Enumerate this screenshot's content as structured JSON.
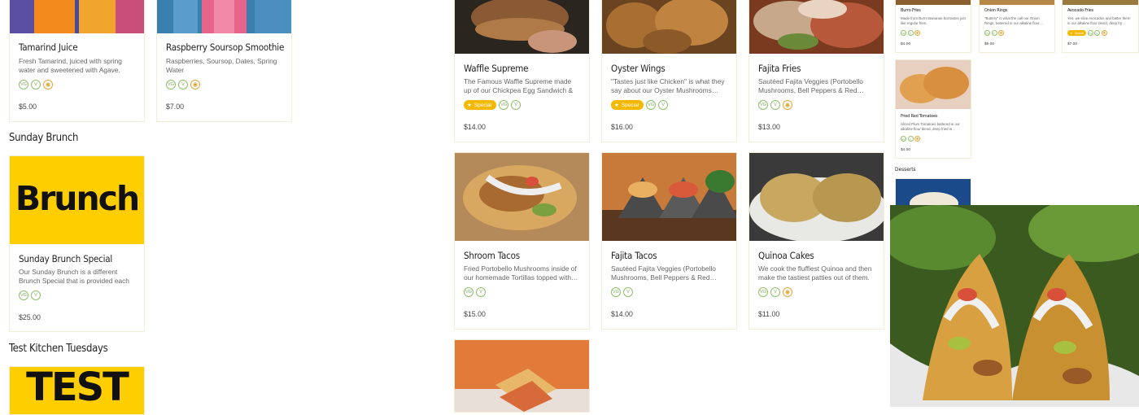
{
  "colors": {
    "accent": "#f5b800",
    "vegan_green": "#7aa85a",
    "gluten_free_gold": "#e0a83a",
    "card_border": "#f3ecd6"
  },
  "left": {
    "drinks": [
      {
        "title": "Tamarind Juice",
        "desc": "Fresh Tamarind, juiced with spring water and sweetened with Agave.",
        "price": "$5.00"
      },
      {
        "title": "Raspberry Soursop Smoothie",
        "desc": "Raspberries, Soursop, Dates, Spring Water",
        "price": "$7.00"
      }
    ],
    "sunday_brunch": {
      "heading": "Sunday Brunch",
      "banner_text": "Brunch",
      "title": "Sunday Brunch Special",
      "desc": "Our Sunday Brunch is a different Brunch Special that is provided each week.…",
      "price": "$25.00"
    },
    "test_kitchen": {
      "heading": "Test Kitchen Tuesdays",
      "banner_text": "TEST"
    }
  },
  "middle": {
    "cards": [
      {
        "title": "Waffle Supreme",
        "desc": "The Famous Waffle Supreme made up of our Chickpea Egg Sandwich & our…",
        "price": "$14.00",
        "special": "Special"
      },
      {
        "title": "Oyster Wings",
        "desc": "\"Tastes just like Chicken\" is what they say about our Oyster Mushrooms…",
        "price": "$16.00",
        "special": "Special"
      },
      {
        "title": "Fajita Fries",
        "desc": "Sautéed Fajita Veggies (Portobello Mushrooms, Bell Peppers & Red…",
        "price": "$13.00"
      },
      {
        "title": "Shroom Tacos",
        "desc": "Fried Portobello Mushrooms inside of our homemade Tortillas topped with…",
        "price": "$15.00"
      },
      {
        "title": "Fajita Tacos",
        "desc": "Sautéed Fajita Veggies (Portobello Mushrooms, Bell Peppers & Red…",
        "price": "$14.00"
      },
      {
        "title": "Quinoa Cakes",
        "desc": "We cook the fluffiest Quinoa and then make the tastiest patties out of them.",
        "price": "$11.00"
      }
    ]
  },
  "mini": {
    "cards": [
      {
        "title": "Burro Fries",
        "desc": "Made from Burro Bananas but tastes just like regular fries.",
        "price": "$4.00"
      },
      {
        "title": "Onion Rings",
        "desc": "\"Buttery\" is what the call our Onion Rings, battered in our alkaline flour…",
        "price": "$5.00"
      },
      {
        "title": "Avocado Fries",
        "desc": "Yes, we slice Avocados and batter them in our alkaline flour blend, deep fry…",
        "price": "$7.00",
        "special": "Special"
      },
      {
        "title": "Fried Red Tomatoes",
        "desc": "Sliced Plum Tomatoes battered in our alkaline flour blend, deep fried in…",
        "price": "$4.00"
      }
    ],
    "desserts_heading": "Desserts"
  },
  "badge_labels": {
    "vg": "VG",
    "v": "V",
    "gf": "✺"
  }
}
